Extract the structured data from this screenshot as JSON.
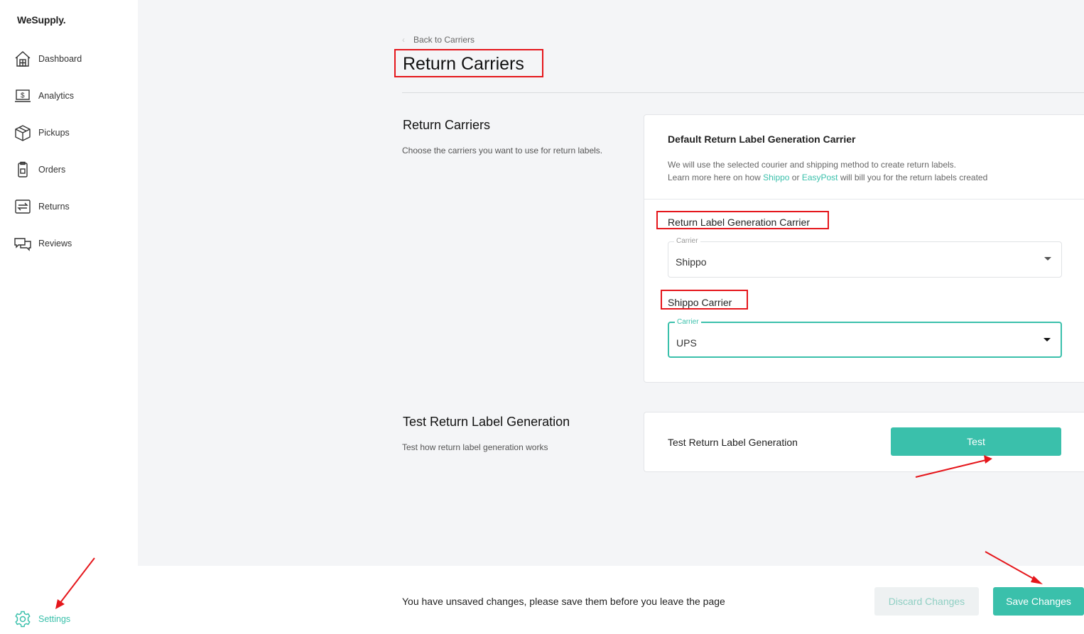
{
  "app": {
    "logo": "WeSupply."
  },
  "sidebar": {
    "items": [
      {
        "label": "Dashboard",
        "icon": "dashboard-icon"
      },
      {
        "label": "Analytics",
        "icon": "analytics-icon"
      },
      {
        "label": "Pickups",
        "icon": "pickups-icon"
      },
      {
        "label": "Orders",
        "icon": "orders-icon"
      },
      {
        "label": "Returns",
        "icon": "returns-icon"
      },
      {
        "label": "Reviews",
        "icon": "reviews-icon"
      }
    ],
    "settings": {
      "label": "Settings",
      "icon": "gear-icon"
    }
  },
  "header": {
    "back_label": "Back to Carriers",
    "title": "Return Carriers"
  },
  "return_carriers_section": {
    "title": "Return Carriers",
    "description": "Choose the carriers you want to use for return labels.",
    "card": {
      "title": "Default Return Label Generation Carrier",
      "text_line1": "We will use the selected courier and shipping method to create return labels.",
      "text_line2_prefix": "Learn more here on how ",
      "link_shippo": "Shippo",
      "text_or": " or ",
      "link_easypost": "EasyPost",
      "text_line2_suffix": " will bill you for the return labels created",
      "generation_carrier_label": "Return Label Generation Carrier",
      "generation_carrier_field": {
        "legend": "Carrier",
        "value": "Shippo"
      },
      "shippo_carrier_label": "Shippo Carrier",
      "shippo_carrier_field": {
        "legend": "Carrier",
        "value": "UPS"
      }
    }
  },
  "test_section": {
    "title": "Test Return Label Generation",
    "description": "Test how return label generation works",
    "card_label": "Test Return Label Generation",
    "button_label": "Test"
  },
  "bottom_bar": {
    "message": "You have unsaved changes, please save them before you leave the page",
    "discard_label": "Discard Changes",
    "save_label": "Save Changes"
  },
  "colors": {
    "accent": "#3ac0ab",
    "annotation": "#e5161b"
  }
}
